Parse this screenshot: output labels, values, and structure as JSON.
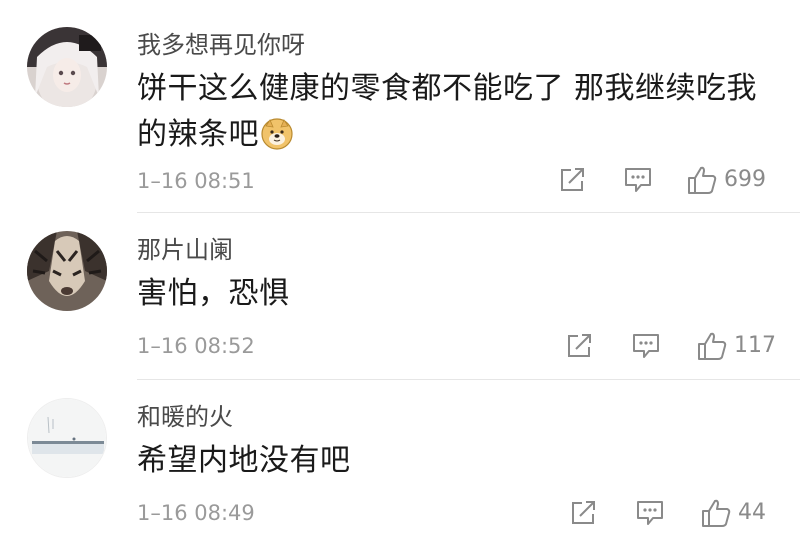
{
  "comments": [
    {
      "username": "我多想再见你呀",
      "text": "饼干这么健康的零食都不能吃了 那我继续吃我的辣条吧",
      "emoji": "doge-emoji",
      "timestamp": "1–16 08:51",
      "likes": "699"
    },
    {
      "username": "那片山阑",
      "text": "害怕，恐惧",
      "timestamp": "1–16 08:52",
      "likes": "117"
    },
    {
      "username": "和暖的火",
      "text": "希望内地没有吧",
      "timestamp": "1–16 08:49",
      "likes": "44"
    }
  ],
  "icons": {
    "share": "share-icon",
    "reply": "comment-icon",
    "like": "thumbs-up-icon"
  },
  "colors": {
    "username": "#4a4a4a",
    "text": "#1a1a1a",
    "meta": "#9a9a9a",
    "divider": "#e6e6e6"
  }
}
